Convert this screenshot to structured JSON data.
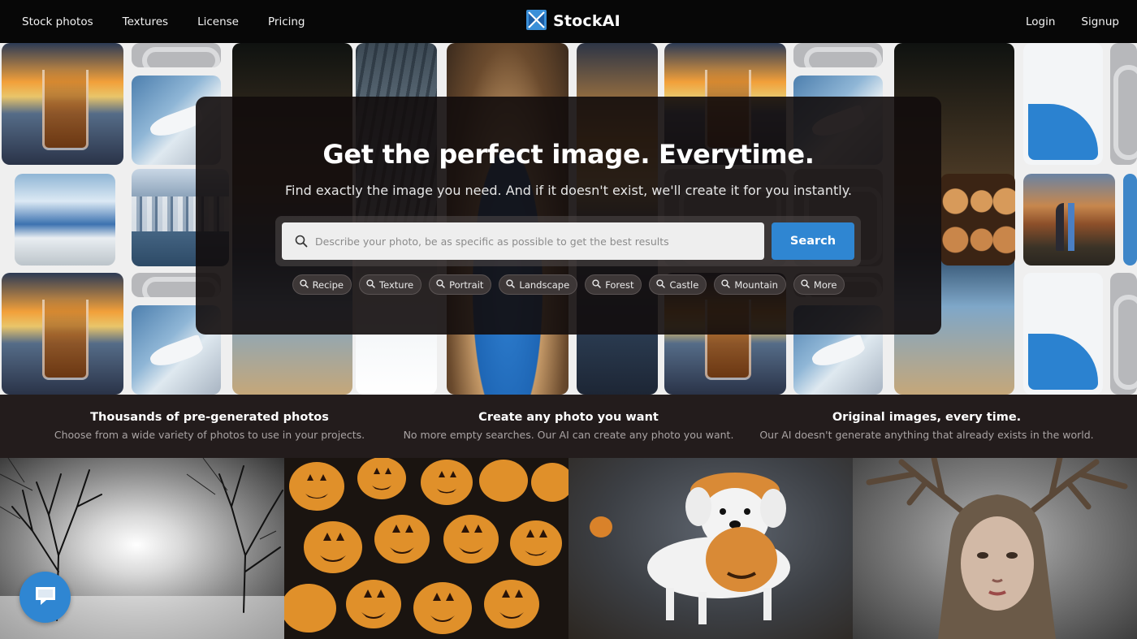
{
  "nav": {
    "left_links": [
      "Stock photos",
      "Textures",
      "License",
      "Pricing"
    ],
    "brand": "StockAI",
    "login": "Login",
    "signup": "Signup"
  },
  "hero": {
    "title": "Get the perfect image. Everytime.",
    "subtitle": "Find exactly the image you need. And if it doesn't exist, we'll create it for you instantly.",
    "search": {
      "placeholder": "Describe your photo, be as specific as possible to get the best results",
      "value": "",
      "button": "Search"
    },
    "chips": [
      "Recipe",
      "Texture",
      "Portrait",
      "Landscape",
      "Forest",
      "Castle",
      "Mountain",
      "More"
    ]
  },
  "features": [
    {
      "title": "Thousands of pre-generated photos",
      "desc": "Choose from a wide variety of photos to use in your projects."
    },
    {
      "title": "Create any photo you want",
      "desc": "No more empty searches. Our AI can create any photo you want."
    },
    {
      "title": "Original images, every time.",
      "desc": "Our AI doesn't generate anything that already exists in the world."
    }
  ],
  "colors": {
    "accent": "#2f86d2",
    "nav_bg": "#070707",
    "page_bg": "#231c1c"
  },
  "icons": {
    "brand": "stockai-logo-icon",
    "search": "search-icon",
    "chip": "search-icon",
    "chat": "chat-bubble-icon"
  }
}
